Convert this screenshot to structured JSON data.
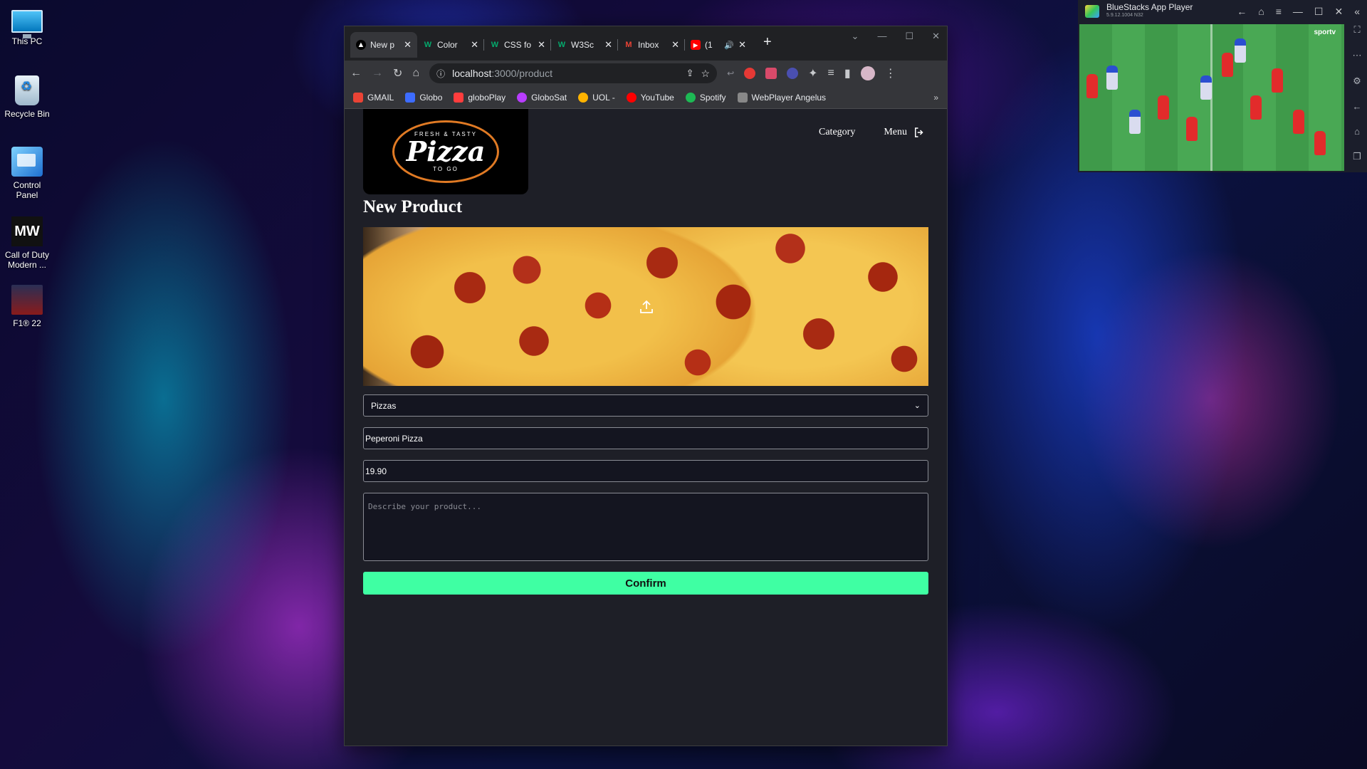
{
  "desktop": {
    "icons": [
      {
        "label": "This PC"
      },
      {
        "label": "Recycle Bin"
      },
      {
        "label": "Control Panel"
      },
      {
        "label": "Call of Duty Modern ..."
      },
      {
        "label": "F1® 22"
      }
    ]
  },
  "browser": {
    "tabs": [
      {
        "title": "New p",
        "favicon": "N"
      },
      {
        "title": "Color",
        "favicon": "W"
      },
      {
        "title": "CSS fo",
        "favicon": "W"
      },
      {
        "title": "W3Sc",
        "favicon": "W"
      },
      {
        "title": "Inbox",
        "favicon": "M"
      },
      {
        "title": "(1",
        "favicon": "▶"
      }
    ],
    "new_tab": "+",
    "address": {
      "host": "localhost",
      "path": ":3000/product"
    },
    "bookmarks": [
      {
        "label": "GMAIL",
        "color": "#ea4335"
      },
      {
        "label": "Globo",
        "color": "#3d6cff"
      },
      {
        "label": "globoPlay",
        "color": "#ff3d3d"
      },
      {
        "label": "GloboSat",
        "color": "#b83dff"
      },
      {
        "label": "UOL -",
        "color": "#ffb300"
      },
      {
        "label": "YouTube",
        "color": "#ff0000"
      },
      {
        "label": "Spotify",
        "color": "#1db954"
      },
      {
        "label": "WebPlayer Angelus",
        "color": "#888888"
      }
    ],
    "more_bookmarks": "»"
  },
  "page": {
    "logo": {
      "top": "FRESH & TASTY",
      "main": "Pizza",
      "bottom": "TO GO"
    },
    "nav": {
      "category": "Category",
      "menu": "Menu"
    },
    "title": "New Product",
    "category_select": {
      "value": "Pizzas"
    },
    "name_input": {
      "value": "Peperoni Pizza"
    },
    "price_input": {
      "value": "19.90"
    },
    "description": {
      "placeholder": "Describe your product..."
    },
    "confirm_label": "Confirm"
  },
  "bluestacks": {
    "title": "BlueStacks App Player",
    "version": "5.9.12.1004 N32",
    "channel": "sportv"
  },
  "colors": {
    "confirm": "#3fffa3",
    "page_bg": "#1e1f27"
  }
}
